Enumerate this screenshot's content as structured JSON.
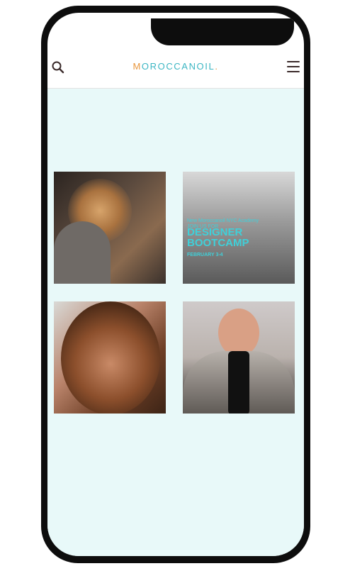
{
  "header": {
    "logo_first": "M",
    "logo_rest": "OROCCANOIL",
    "logo_dot": ".",
    "search_icon": "search-icon",
    "menu_icon": "hamburger-menu-icon"
  },
  "colors": {
    "brand_teal": "#3cb6c3",
    "brand_orange": "#e8963d",
    "background": "#e8f9f9"
  },
  "gallery": [
    {
      "label": "hairstylist-curling-hair-photo"
    },
    {
      "label": "designer-bootcamp-event-photo",
      "overlay_sub": "New Moroccanoil NYC Academy",
      "overlay_join": "JOIN US FOR",
      "overlay_title_1": "DESIGNER",
      "overlay_title_2": "BOOTCAMP",
      "overlay_date": "FEBRUARY 3-4"
    },
    {
      "label": "curly-hair-model-photo"
    },
    {
      "label": "smiling-man-photo"
    }
  ]
}
